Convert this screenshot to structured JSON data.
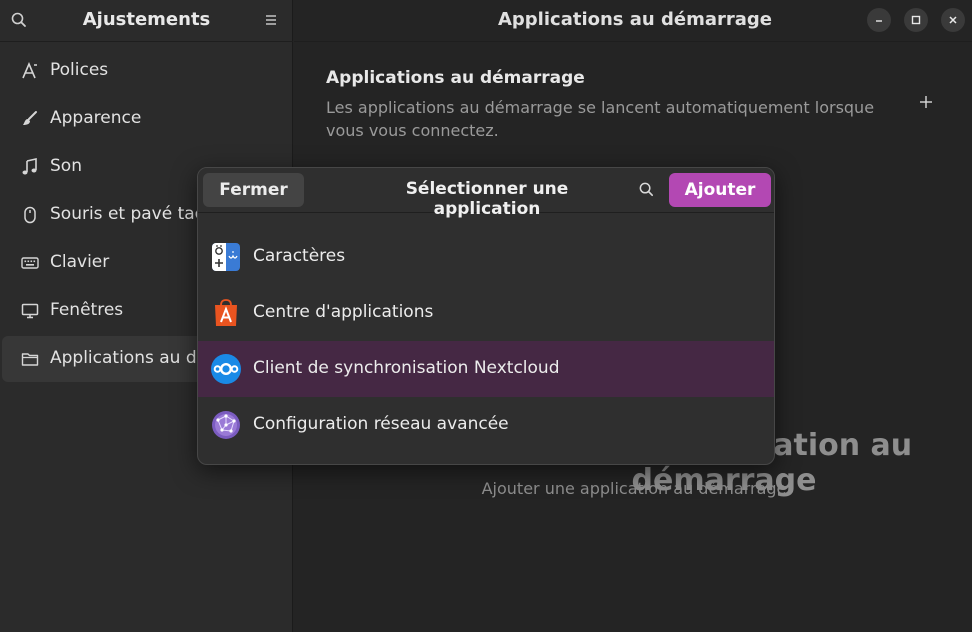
{
  "sidebar": {
    "title": "Ajustements",
    "items": [
      {
        "label": "Polices",
        "icon": "font-icon"
      },
      {
        "label": "Apparence",
        "icon": "brush-icon"
      },
      {
        "label": "Son",
        "icon": "music-note-icon"
      },
      {
        "label": "Souris et pavé tactile",
        "icon": "mouse-icon"
      },
      {
        "label": "Clavier",
        "icon": "keyboard-icon"
      },
      {
        "label": "Fenêtres",
        "icon": "monitor-icon"
      },
      {
        "label": "Applications au démarrage",
        "icon": "folder-icon"
      }
    ]
  },
  "main": {
    "title": "Applications au démarrage",
    "section_title": "Applications au démarrage",
    "section_desc": "Les applications au démarrage se lancent automatiquement lorsque vous vous connectez.",
    "empty_title": "Aucune application au démarrage",
    "empty_subtitle": "Ajouter une application au démarrage"
  },
  "dialog": {
    "close_label": "Fermer",
    "title": "Sélectionner une application",
    "add_label": "Ajouter",
    "apps": [
      {
        "label": "Caractères",
        "icon": "characters-app-icon"
      },
      {
        "label": "Centre d'applications",
        "icon": "app-center-icon"
      },
      {
        "label": "Client de synchronisation Nextcloud",
        "icon": "nextcloud-icon"
      },
      {
        "label": "Configuration réseau avancée",
        "icon": "network-config-icon"
      }
    ]
  },
  "colors": {
    "accent": "#b348b3",
    "selected_row": "#452844",
    "background": "#242424",
    "sidebar_bg": "#2b2b2b"
  }
}
